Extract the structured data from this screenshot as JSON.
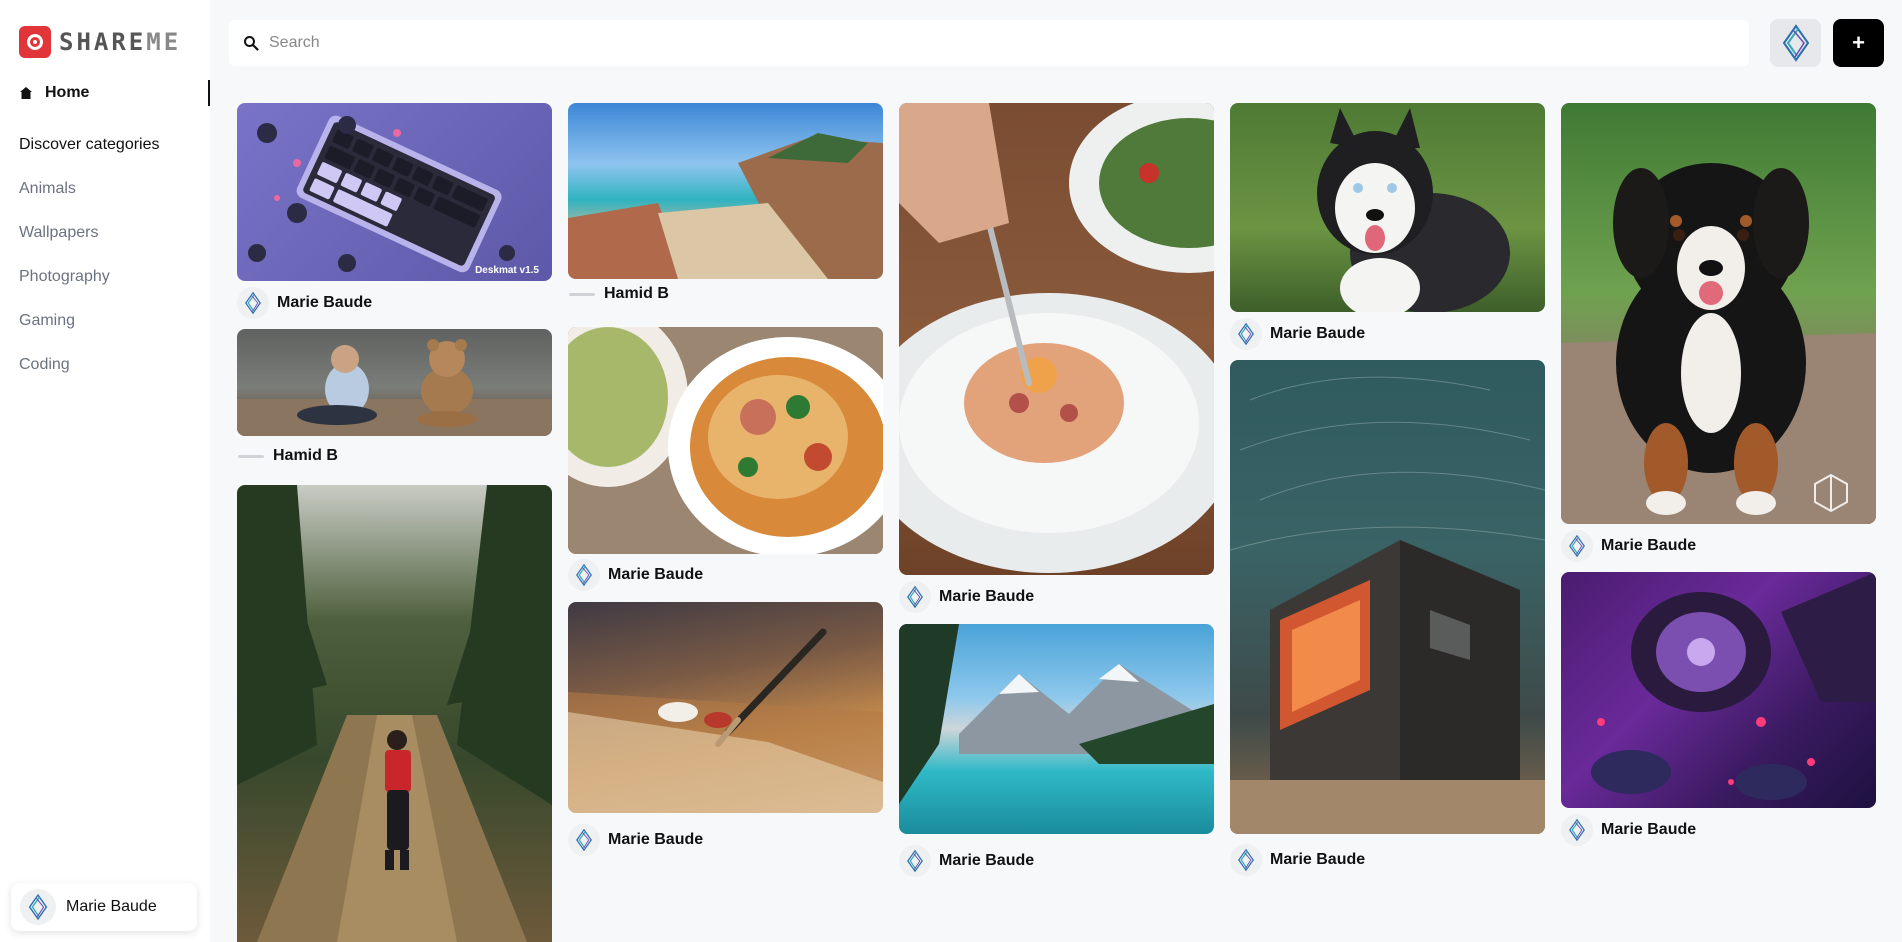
{
  "app": {
    "logo_text": "SHAREME",
    "logo_left": "SHARE",
    "logo_right": "ME"
  },
  "sidebar": {
    "home_label": "Home",
    "discover_label": "Discover categories",
    "categories": [
      "Animals",
      "Wallpapers",
      "Photography",
      "Gaming",
      "Coding"
    ],
    "user_name": "Marie Baude"
  },
  "search": {
    "placeholder": "Search",
    "value": ""
  },
  "add_button": {
    "label": "+"
  },
  "pins": [
    {
      "author": "Marie Baude",
      "subject": "purple keyboard on deskmat",
      "watermark": "Deskmat v1.5"
    },
    {
      "author": "Hamid B",
      "subject": "child with teddy bear"
    },
    {
      "author": "",
      "subject": "woman walking forest path"
    },
    {
      "author": "Hamid B",
      "subject": "rocky beach turquoise sea"
    },
    {
      "author": "Marie Baude",
      "subject": "noodle soup bowl"
    },
    {
      "author": "Marie Baude",
      "subject": "paint brush on palette"
    },
    {
      "author": "Marie Baude",
      "subject": "pasta carbonara plate"
    },
    {
      "author": "Marie Baude",
      "subject": "mountain lake"
    },
    {
      "author": "Marie Baude",
      "subject": "husky dog"
    },
    {
      "author": "Marie Baude",
      "subject": "cabin under star trails"
    },
    {
      "author": "Marie Baude",
      "subject": "bernese puppy"
    },
    {
      "author": "Marie Baude",
      "subject": "gaming desk neon"
    }
  ],
  "colors": {
    "brand_red": "#e2353a",
    "button_black": "#000000",
    "muted_text": "#6b7280"
  }
}
